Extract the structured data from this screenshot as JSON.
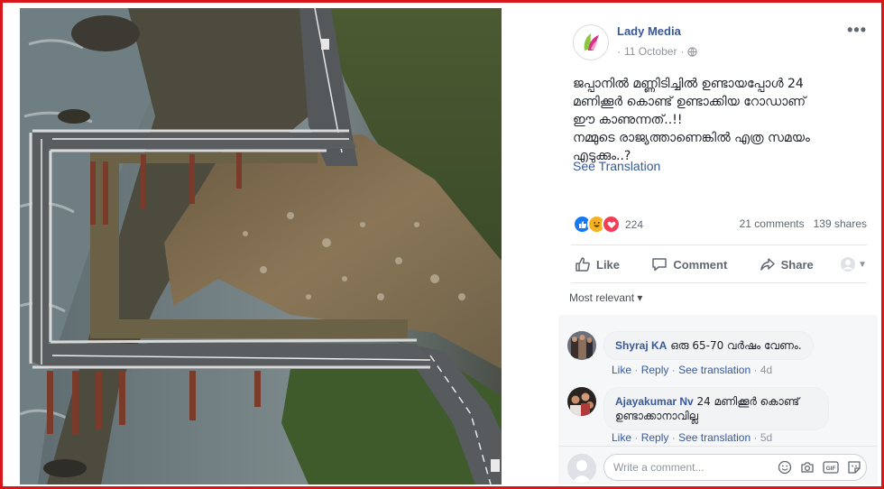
{
  "post": {
    "page_name": "Lady Media",
    "date": "11 October",
    "date_separator": "·",
    "text_lines": [
      "ജപ്പാനിൽ മണ്ണിടിച്ചിൽ ഉണ്ടായപ്പോൾ 24",
      "മണിക്കൂർ കൊണ്ട് ഉണ്ടാക്കിയ റോഡാണ്",
      "ഈ കാണുന്നത്..!!",
      "നമ്മുടെ രാജ്യത്താണെങ്കിൽ എത്ര സമയം",
      "എടുക്കും..?"
    ],
    "see_translation": "See Translation",
    "reaction_count": "224",
    "comments_count": "21 comments",
    "shares_count": "139 shares",
    "reaction_icons": [
      "like-icon",
      "haha-icon",
      "love-icon"
    ]
  },
  "actions": {
    "like": "Like",
    "comment": "Comment",
    "share": "Share"
  },
  "filter": {
    "label": "Most relevant",
    "arrow": "▾"
  },
  "comments": [
    {
      "author": "Shyraj KA",
      "text": "ഒരു 65-70 വർഷം വേണം.",
      "like": "Like",
      "reply": "Reply",
      "see_translation": "See translation",
      "time": "4d"
    },
    {
      "author": "Ajayakumar Nv",
      "text_line1": "24 മണിക്കൂർ കൊണ്ട്",
      "text_line2": "ഉണ്ടാക്കാനാവില്ല",
      "like": "Like",
      "reply": "Reply",
      "see_translation": "See translation",
      "time": "5d"
    }
  ],
  "composer": {
    "placeholder": "Write a comment...",
    "icons": [
      "emoji-icon",
      "camera-icon",
      "gif-icon",
      "sticker-icon"
    ]
  },
  "colors": {
    "frame": "#d8161b",
    "link": "#365899",
    "like_blue": "#1877f2",
    "love_red": "#f33e58",
    "haha_yellow": "#f7b125"
  }
}
